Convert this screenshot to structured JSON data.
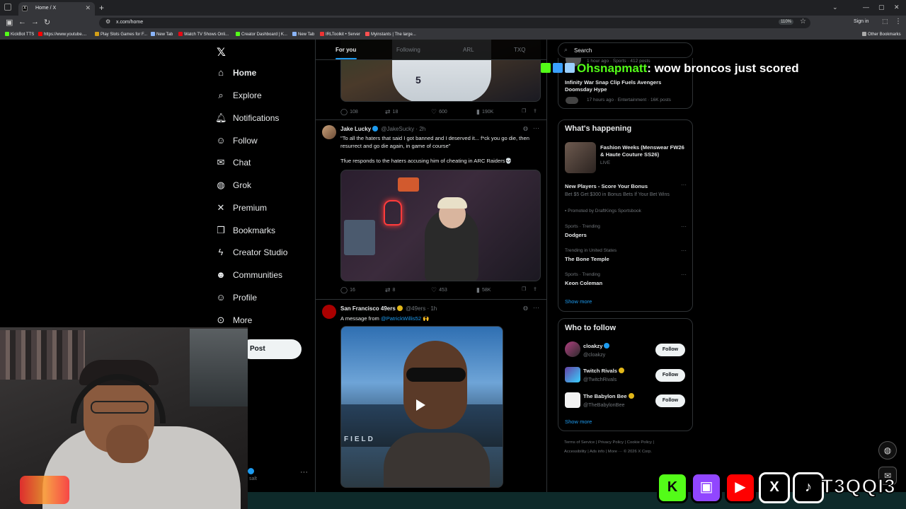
{
  "browser": {
    "tab_title": "Home / X",
    "tab_favicon": "X",
    "url": "x.com/home",
    "zoom": "110%",
    "signin": "Sign in",
    "bookmarks": [
      {
        "label": "KickBot TTS",
        "color": "#53fc18"
      },
      {
        "label": "https://www.youtube....",
        "color": "#ff0000"
      },
      {
        "label": "Play Slots Games for F...",
        "color": "#d4a017"
      },
      {
        "label": "New Tab",
        "color": "#8ab4f8"
      },
      {
        "label": "Watch TV Shows Onli...",
        "color": "#e50914"
      },
      {
        "label": "Creator Dashboard | K...",
        "color": "#53fc18"
      },
      {
        "label": "New Tab",
        "color": "#8ab4f8"
      },
      {
        "label": "IRLToolkit • Server",
        "color": "#e33"
      },
      {
        "label": "Myinstants | The large...",
        "color": "#ff5050"
      }
    ],
    "other_bookmarks": "Other Bookmarks"
  },
  "nav": {
    "items": [
      {
        "label": "Home",
        "icon": "home-icon",
        "glyph": "⌂"
      },
      {
        "label": "Explore",
        "icon": "search-icon",
        "glyph": "⌕"
      },
      {
        "label": "Notifications",
        "icon": "bell-icon",
        "glyph": "♫"
      },
      {
        "label": "Follow",
        "icon": "person-add-icon",
        "glyph": "☺"
      },
      {
        "label": "Chat",
        "icon": "mail-icon",
        "glyph": "✉"
      },
      {
        "label": "Grok",
        "icon": "grok-icon",
        "glyph": "◌"
      },
      {
        "label": "Premium",
        "icon": "x-icon",
        "glyph": "✕"
      },
      {
        "label": "Bookmarks",
        "icon": "bookmark-icon",
        "glyph": "❒"
      },
      {
        "label": "Creator Studio",
        "icon": "lightning-icon",
        "glyph": "⚡"
      },
      {
        "label": "Communities",
        "icon": "people-icon",
        "glyph": "☻"
      },
      {
        "label": "Profile",
        "icon": "user-icon",
        "glyph": "☺"
      },
      {
        "label": "More",
        "icon": "more-circle-icon",
        "glyph": "⋯"
      }
    ],
    "post_label": "Post",
    "account_handle": "salt"
  },
  "timeline": {
    "tabs": [
      "For you",
      "Following",
      "ARL",
      "TXQ"
    ],
    "post0": {
      "replies": "108",
      "reposts": "18",
      "likes": "600",
      "views": "190K",
      "jersey_num": "5"
    },
    "post1": {
      "name": "Jake Lucky",
      "handle": "@JakeSucky",
      "time": "2h",
      "text1": "\"To all the haters that said I got banned and I deserved it... f*ck you go die, then resurrect and go die again, in game of course\"",
      "text2": "Tfue responds to the haters accusing him of cheating in ARC Raiders💀",
      "replies": "16",
      "reposts": "8",
      "likes": "453",
      "views": "58K"
    },
    "post2": {
      "name": "San Francisco 49ers",
      "handle": "@49ers",
      "time": "1h",
      "text_prefix": "A message from ",
      "mention": "@PatrickWillis52",
      "text_suffix": " 🙌",
      "field_text": "FIELD"
    }
  },
  "right": {
    "search_placeholder": "Search",
    "top_trend1_meta": "1 hour ago · Sports · 412 posts",
    "top_trend2_title": "Infinity War Snap Clip Fuels Avengers Doomsday Hype",
    "top_trend2_meta": "17 hours ago · Entertainment · 16K posts",
    "happening_title": "What's happening",
    "event_title": "Fashion Weeks (Menswear FW26 & Haute Couture SS26)",
    "event_status": "LIVE",
    "promo_title": "New Players - Score Your Bonus",
    "promo_text": "Bet $5 Get $300 in Bonus Bets If Your Bet Wins",
    "promo_by": "Promoted by DraftKings Sportsbook",
    "trends": [
      {
        "meta": "Sports · Trending",
        "title": "Dodgers"
      },
      {
        "meta": "Trending in United States",
        "title": "The Bone Temple"
      },
      {
        "meta": "Sports · Trending",
        "title": "Keon Coleman"
      }
    ],
    "show_more": "Show more",
    "wtf_title": "Who to follow",
    "follow_label": "Follow",
    "accounts": [
      {
        "name": "cloakzy",
        "handle": "@cloakzy",
        "badge": "blue"
      },
      {
        "name": "Twitch Rivals",
        "handle": "@TwitchRivals",
        "badge": "gold"
      },
      {
        "name": "The Babylon Bee",
        "handle": "@TheBabylonBee",
        "badge": "gold"
      }
    ],
    "footer_line1": [
      "Terms of Service",
      "|",
      "Privacy Policy",
      "|",
      "Cookie Policy",
      "|"
    ],
    "footer_line2": [
      "Accessibility",
      "|",
      "Ads info",
      "|",
      "More ···",
      "© 2026 X Corp."
    ]
  },
  "overlay": {
    "chat_user": "Ohsnapmatt",
    "chat_message": ": wow broncos just scored",
    "social_handle": "T3QQI3",
    "socials": [
      {
        "name": "kick-icon",
        "glyph": "K",
        "color": "#53fc18"
      },
      {
        "name": "twitch-icon",
        "glyph": "▣",
        "color": "#9146ff"
      },
      {
        "name": "youtube-icon",
        "glyph": "▶",
        "color": "#ff0000"
      },
      {
        "name": "x-icon",
        "glyph": "X",
        "color": "#000000"
      },
      {
        "name": "tiktok-icon",
        "glyph": "♪",
        "color": "#000000"
      }
    ]
  }
}
